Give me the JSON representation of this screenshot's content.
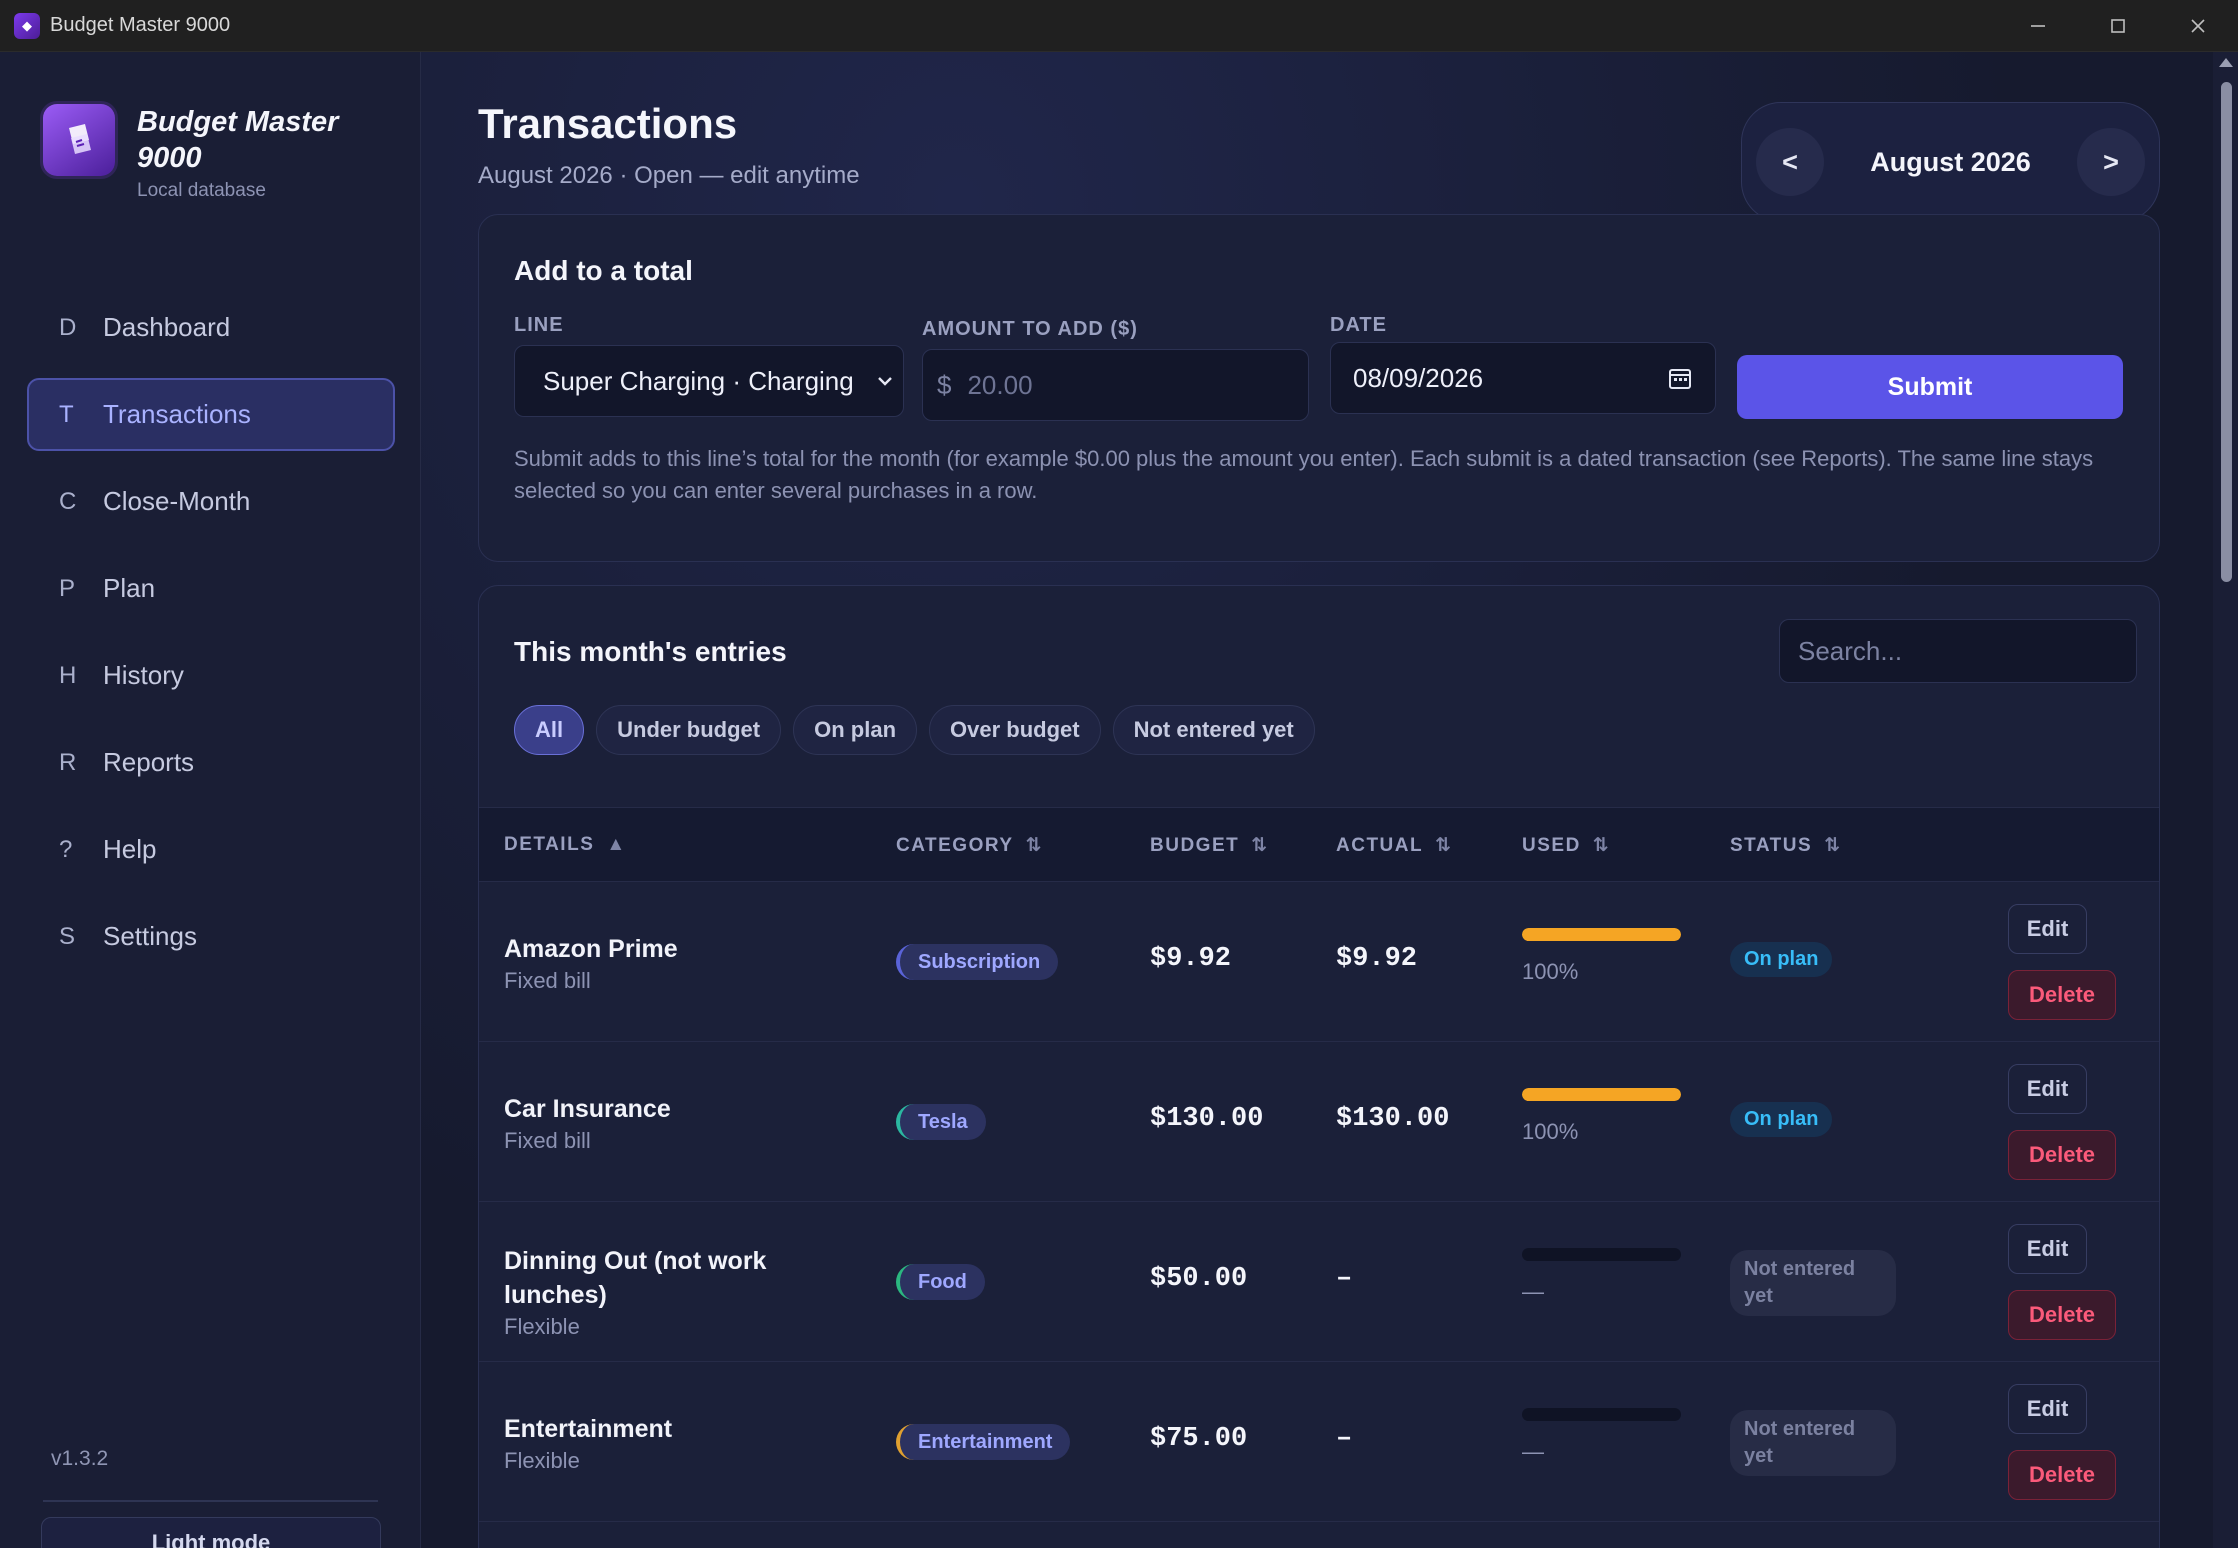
{
  "window": {
    "title": "Budget Master 9000"
  },
  "brand": {
    "name": "Budget Master 9000",
    "subtitle": "Local database"
  },
  "nav": [
    {
      "letter": "D",
      "label": "Dashboard",
      "active": false
    },
    {
      "letter": "T",
      "label": "Transactions",
      "active": true
    },
    {
      "letter": "C",
      "label": "Close-Month",
      "active": false
    },
    {
      "letter": "P",
      "label": "Plan",
      "active": false
    },
    {
      "letter": "H",
      "label": "History",
      "active": false
    },
    {
      "letter": "R",
      "label": "Reports",
      "active": false
    },
    {
      "letter": "?",
      "label": "Help",
      "active": false
    },
    {
      "letter": "S",
      "label": "Settings",
      "active": false
    }
  ],
  "sidebar_footer": {
    "version": "v1.3.2",
    "theme_toggle": "Light mode"
  },
  "header": {
    "title": "Transactions",
    "subtitle": "August 2026 · Open — edit anytime",
    "month": {
      "prev": "<",
      "label": "August 2026",
      "next": ">"
    }
  },
  "add_form": {
    "title": "Add to a total",
    "line_label": "LINE",
    "line_value": "Super Charging · Charging",
    "amount_label": "AMOUNT TO ADD ($)",
    "amount_prefix": "$",
    "amount_placeholder": "20.00",
    "date_label": "DATE",
    "date_value": "08/09/2026",
    "submit": "Submit",
    "hint": "Submit adds to this line’s total for the month (for example $0.00 plus the amount you enter). Each submit is a dated transaction (see Reports). The same line stays selected so you can enter several purchases in a row."
  },
  "entries": {
    "title": "This month's entries",
    "search_placeholder": "Search...",
    "filters": [
      "All",
      "Under budget",
      "On plan",
      "Over budget",
      "Not entered yet"
    ],
    "active_filter": "All",
    "columns": {
      "details": "DETAILS",
      "details_sort": "▲",
      "category": "CATEGORY",
      "budget": "BUDGET",
      "actual": "ACTUAL",
      "used": "USED",
      "status": "STATUS",
      "sort_icon": "⇅"
    },
    "rows": [
      {
        "name": "Amazon Prime",
        "type": "Fixed bill",
        "category": "Subscription",
        "accent": "#5a63d8",
        "budget": "$9.92",
        "actual": "$9.92",
        "used_fraction": 1.0,
        "used_label": "100%",
        "status": "On plan",
        "status_kind": "onplan",
        "edit": "Edit",
        "delete": "Delete"
      },
      {
        "name": "Car Insurance",
        "type": "Fixed bill",
        "category": "Tesla",
        "accent": "#2bb7a0",
        "budget": "$130.00",
        "actual": "$130.00",
        "used_fraction": 1.0,
        "used_label": "100%",
        "status": "On plan",
        "status_kind": "onplan",
        "edit": "Edit",
        "delete": "Delete"
      },
      {
        "name": "Dinning Out (not work lunches)",
        "type": "Flexible",
        "category": "Food",
        "accent": "#2bb780",
        "budget": "$50.00",
        "actual": "–",
        "used_fraction": 0,
        "used_label": "—",
        "status": "Not entered yet",
        "status_kind": "none",
        "edit": "Edit",
        "delete": "Delete"
      },
      {
        "name": "Entertainment",
        "type": "Flexible",
        "category": "Entertainment",
        "accent": "#e0a030",
        "budget": "$75.00",
        "actual": "–",
        "used_fraction": 0,
        "used_label": "—",
        "status": "Not entered yet",
        "status_kind": "none",
        "edit": "Edit",
        "delete": "Delete"
      }
    ]
  }
}
